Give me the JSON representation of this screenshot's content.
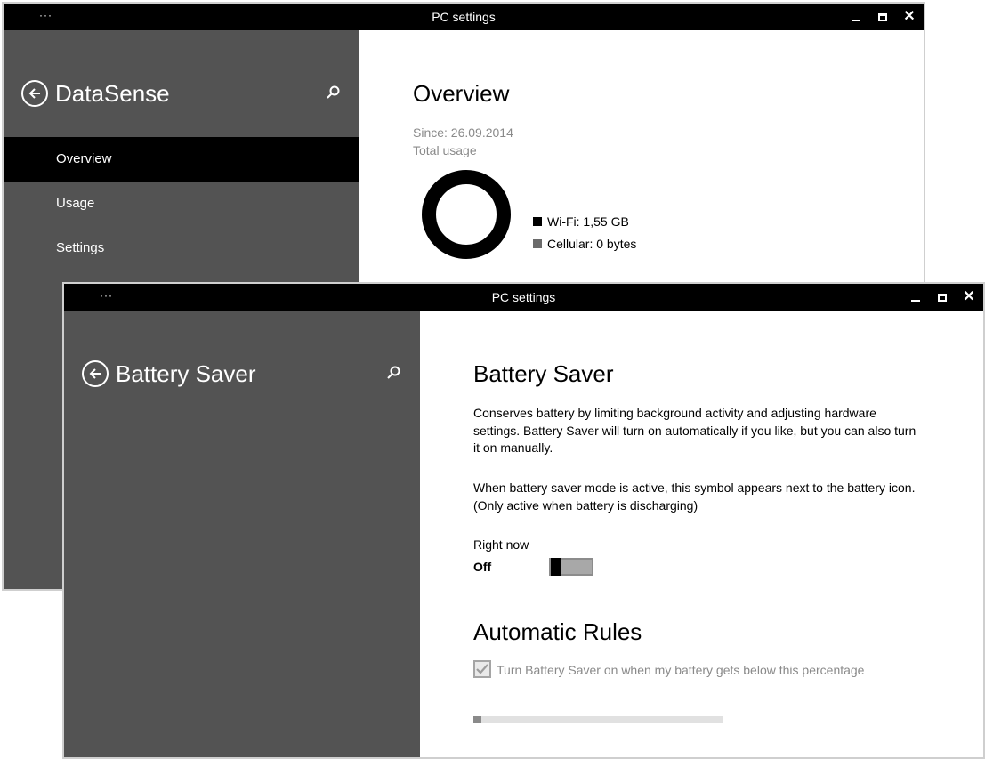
{
  "back_window": {
    "title": "PC settings",
    "menu_dots": "···",
    "sidebar": {
      "title": "DataSense",
      "nav": [
        {
          "label": "Overview",
          "selected": true
        },
        {
          "label": "Usage",
          "selected": false
        },
        {
          "label": "Settings",
          "selected": false
        }
      ]
    },
    "content": {
      "heading": "Overview",
      "since": "Since: 26.09.2014",
      "total_usage_label": "Total usage",
      "usage": {
        "wifi_fraction": 1.0,
        "cellular_fraction": 0.0
      },
      "legend": [
        {
          "label": "Wi-Fi: 1,55 GB",
          "color": "#000000"
        },
        {
          "label": "Cellular: 0 bytes",
          "color": "#6b6b6b"
        }
      ]
    }
  },
  "front_window": {
    "title": "PC settings",
    "menu_dots": "···",
    "sidebar": {
      "title": "Battery Saver"
    },
    "content": {
      "heading": "Battery Saver",
      "paragraph1": [
        "Conserves battery by limiting background activity and adjusting hardware",
        "settings. Battery Saver will turn on automatically if you like, but you can also turn",
        "it on manually."
      ],
      "paragraph2": [
        "When battery saver mode is active, this symbol appears next to the battery icon.",
        "(Only active when battery is discharging)"
      ],
      "right_now_label": "Right now",
      "toggle_state": "Off",
      "toggle_on": false,
      "auto_rules_heading": "Automatic Rules",
      "checkbox_label": "Turn Battery Saver on when my battery gets below this percentage",
      "checkbox_checked": true,
      "slider_value": 0.0
    }
  },
  "colors": {
    "sidebar_bg": "#535353",
    "titlebar_bg": "#000000",
    "selected_nav_bg": "#000000",
    "muted_text": "#8a8a8a"
  }
}
